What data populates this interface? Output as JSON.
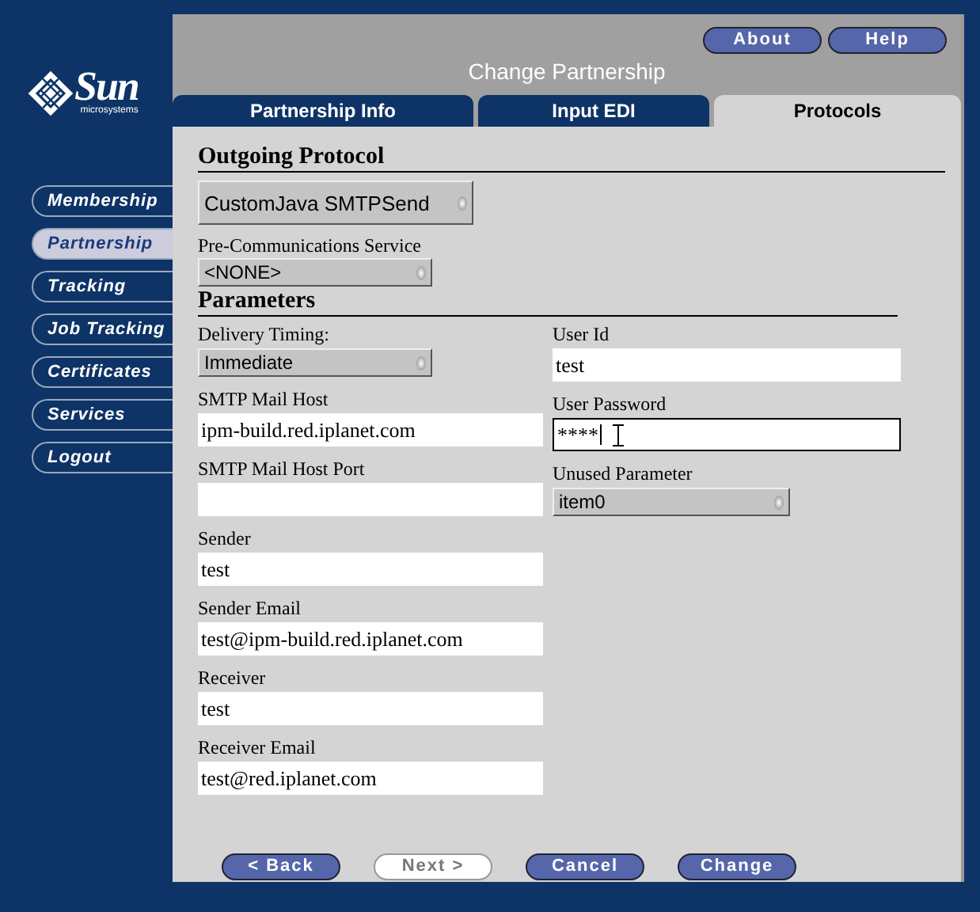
{
  "logo": {
    "name": "Sun",
    "tagline": "microsystems"
  },
  "header": {
    "title": "Change Partnership",
    "buttons": [
      "About",
      "Help"
    ]
  },
  "sidebar": {
    "items": [
      {
        "label": "Membership",
        "selected": false
      },
      {
        "label": "Partnership",
        "selected": true
      },
      {
        "label": "Tracking",
        "selected": false
      },
      {
        "label": "Job Tracking",
        "selected": false
      },
      {
        "label": "Certificates",
        "selected": false
      },
      {
        "label": "Services",
        "selected": false
      },
      {
        "label": "Logout",
        "selected": false
      }
    ]
  },
  "tabs": [
    {
      "label": "Partnership Info",
      "selected": false
    },
    {
      "label": "Input EDI",
      "selected": false
    },
    {
      "label": "Protocols",
      "selected": true
    }
  ],
  "outgoing_protocol": {
    "heading": "Outgoing Protocol",
    "value": "CustomJava SMTPSend"
  },
  "pre_communications": {
    "label": "Pre-Communications Service",
    "value": "<NONE>"
  },
  "parameters": {
    "heading": "Parameters",
    "left": [
      {
        "kind": "select",
        "label": "Delivery Timing:",
        "value": "Immediate",
        "focused": false
      },
      {
        "kind": "text",
        "label": "SMTP Mail Host",
        "value": "ipm-build.red.iplanet.com",
        "focused": false
      },
      {
        "kind": "text",
        "label": "SMTP Mail Host Port",
        "focused": false
      },
      {
        "kind": "text",
        "label": "Sender",
        "value": "test",
        "focused": false
      },
      {
        "kind": "text",
        "label": "Sender Email",
        "value": "test@ipm-build.red.iplanet.com",
        "focused": false
      },
      {
        "kind": "text",
        "label": "Receiver",
        "value": "test",
        "focused": false
      },
      {
        "kind": "text",
        "label": "Receiver Email",
        "value": "test@red.iplanet.com",
        "focused": false
      }
    ],
    "right": [
      {
        "kind": "text",
        "label": "User Id",
        "value": "test",
        "focused": false
      },
      {
        "kind": "password",
        "label": "User Password",
        "value": "****",
        "focused": true
      },
      {
        "kind": "select",
        "label": "Unused Parameter",
        "value": "item0",
        "focused": false
      }
    ]
  },
  "footer_buttons": [
    {
      "label": "< Back",
      "disabled": false
    },
    {
      "label": "Next >",
      "disabled": true
    },
    {
      "label": "Cancel",
      "disabled": false
    },
    {
      "label": "Change",
      "disabled": false
    }
  ]
}
